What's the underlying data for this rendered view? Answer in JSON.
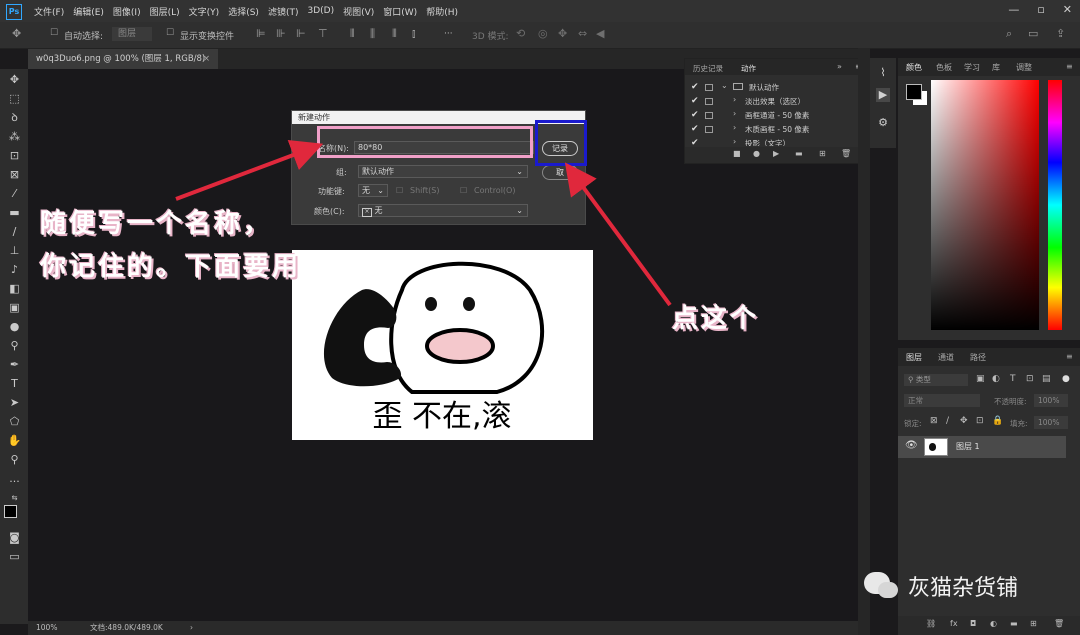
{
  "app": {
    "logo": "Ps"
  },
  "menu": [
    "文件(F)",
    "编辑(E)",
    "图像(I)",
    "图层(L)",
    "文字(Y)",
    "选择(S)",
    "滤镜(T)",
    "3D(D)",
    "视图(V)",
    "窗口(W)",
    "帮助(H)"
  ],
  "window_controls": [
    "—",
    "▫",
    "✕"
  ],
  "options": {
    "auto_select_label": "自动选择:",
    "auto_select_value": "图层",
    "show_transform_label": "显示变换控件",
    "mode_3d_label": "3D 模式:",
    "more_glyph": "···"
  },
  "document": {
    "tab_title": "w0q3Duo6.png @ 100% (图层 1, RGB/8)",
    "close_glyph": "×",
    "zoom": "100%",
    "doc_info": "文档:489.0K/489.0K"
  },
  "actions_panel": {
    "tabs": [
      "历史记录",
      "动作"
    ],
    "rows": [
      {
        "checked": true,
        "label": "默认动作",
        "arrow": "⌄"
      },
      {
        "checked": true,
        "label": "淡出效果（选区）",
        "arrow": "›"
      },
      {
        "checked": true,
        "label": "画框通道 - 50 像素",
        "arrow": "›"
      },
      {
        "checked": true,
        "label": "木质画框 - 50 像素",
        "arrow": "›"
      },
      {
        "checked": true,
        "label": "投影（文字）",
        "arrow": "›"
      }
    ]
  },
  "color_panel": {
    "tabs": [
      "颜色",
      "色板",
      "学习",
      "库",
      "调整"
    ],
    "fg_color": "#000000",
    "bg_color": "#ffffff"
  },
  "layers_panel": {
    "tabs": [
      "图层",
      "通道",
      "路径"
    ],
    "filter_label": "类型",
    "blend_mode": "正常",
    "opacity_label": "不透明度:",
    "opacity_value": "100%",
    "lock_label": "锁定:",
    "fill_label": "填充:",
    "fill_value": "100%",
    "layer_name": "图层 1"
  },
  "dialog": {
    "title": "新建动作",
    "name_label": "名称(N):",
    "name_value": "80*80",
    "group_label": "组:",
    "group_value": "默认动作",
    "fkey_label": "功能键:",
    "fkey_value": "无",
    "shift_label": "Shift(S)",
    "ctrl_label": "Control(O)",
    "color_label": "颜色(C):",
    "color_value": "无",
    "record_button": "记录",
    "cancel_button": "取"
  },
  "annotations": {
    "left_line1": "随便写一个名称，",
    "left_line2": "你记住的。下面要用",
    "right_text": "点这个"
  },
  "meme": {
    "caption": "歪 不在,滚"
  },
  "watermark": {
    "text": "灰猫杂货铺"
  },
  "colors": {
    "arrow": "#e0283c",
    "pink_box": "#f0a0c8",
    "blue_box": "#1a1acd"
  }
}
